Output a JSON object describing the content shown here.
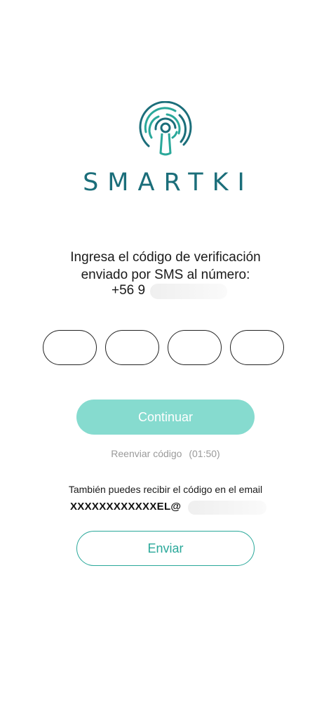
{
  "brand": {
    "name": "SMARTKI",
    "logo_icon": "keyhole-logo-icon",
    "color": "#1b6e7a",
    "accent": "#2aa89a"
  },
  "verification": {
    "instruction_line1": "Ingresa el código de verificación",
    "instruction_line2": "enviado por SMS al número:",
    "phone_prefix": "+56 9",
    "code_length": 4
  },
  "continue_button": {
    "label": "Continuar",
    "color": "#86dbcf"
  },
  "resend": {
    "label": "Reenviar código",
    "timer": "(01:50)"
  },
  "email": {
    "note": "También puedes recibir el código en el email",
    "value": "XXXXXXXXXXXXEL@"
  },
  "send_button": {
    "label": "Enviar"
  }
}
